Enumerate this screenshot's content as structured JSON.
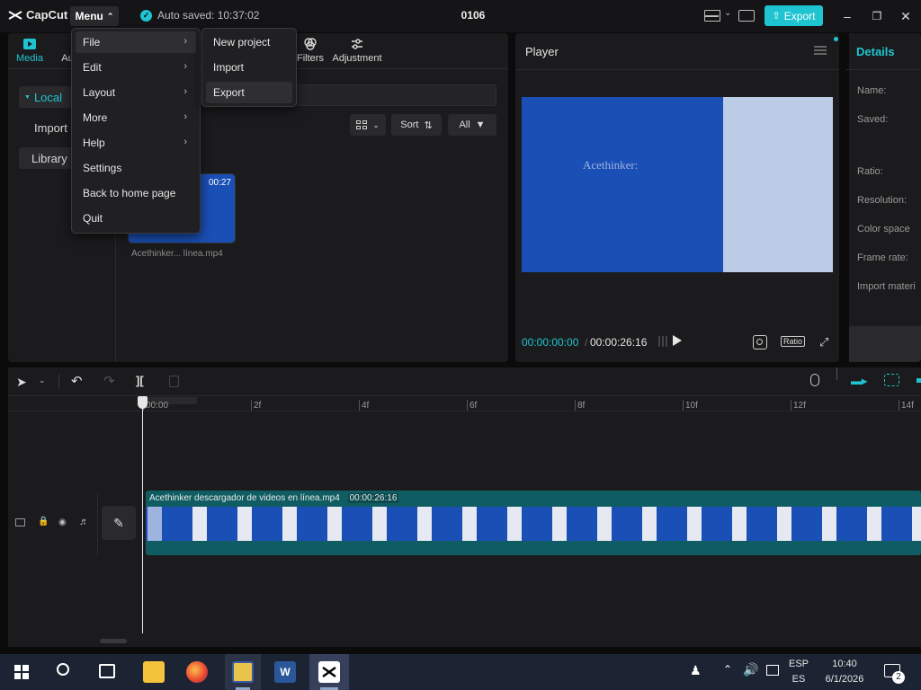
{
  "titlebar": {
    "app_name": "CapCut",
    "menu_label": "Menu",
    "autosave_text": "Auto saved: 10:37:02",
    "project_title": "0106",
    "export_label": "Export"
  },
  "media": {
    "tabs": [
      {
        "label": "Media",
        "icon": "media-icon",
        "active": true
      },
      {
        "label": "Filters",
        "icon": "filters-icon"
      },
      {
        "label": "Adjustment",
        "icon": "adjustment-icon"
      }
    ],
    "sidebar": {
      "local": "Local",
      "import": "Import",
      "library": "Library"
    },
    "toolbar": {
      "sort": "Sort",
      "all": "All"
    },
    "clip": {
      "duration": "00:27",
      "name": "Acethinker... línea.mp4"
    }
  },
  "menu_dropdown": {
    "items": [
      {
        "label": "File",
        "has_submenu": true
      },
      {
        "label": "Edit",
        "has_submenu": true
      },
      {
        "label": "Layout",
        "has_submenu": true
      },
      {
        "label": "More",
        "has_submenu": true
      },
      {
        "label": "Help",
        "has_submenu": true
      },
      {
        "label": "Settings"
      },
      {
        "label": "Back to home page"
      },
      {
        "label": "Quit"
      }
    ],
    "file_submenu": [
      {
        "label": "New project"
      },
      {
        "label": "Import"
      },
      {
        "label": "Export"
      }
    ]
  },
  "player": {
    "title": "Player",
    "watermark": "Acethinker:",
    "current_time": "00:00:00:00",
    "total_time": "00:00:26:16",
    "ratio_label": "Ratio"
  },
  "details": {
    "title": "Details",
    "fields": [
      "Name:",
      "Saved:",
      "Ratio:",
      "Resolution:",
      "Color space",
      "Frame rate:",
      "Import materi"
    ]
  },
  "timeline": {
    "ruler": [
      "00:00",
      "2f",
      "4f",
      "6f",
      "8f",
      "10f",
      "12f",
      "14f"
    ],
    "clip_name": "Acethinker descargador de videos en línea.mp4",
    "clip_duration": "00:00:26:16"
  },
  "taskbar": {
    "lang_top": "ESP",
    "lang_bottom": "ES",
    "time": "10:40",
    "date": "6/1/2026",
    "notif_count": "2"
  },
  "colors": {
    "accent": "#1ec5d1",
    "clip_blue": "#1a4fb5",
    "clip_track": "#0f5d62"
  }
}
